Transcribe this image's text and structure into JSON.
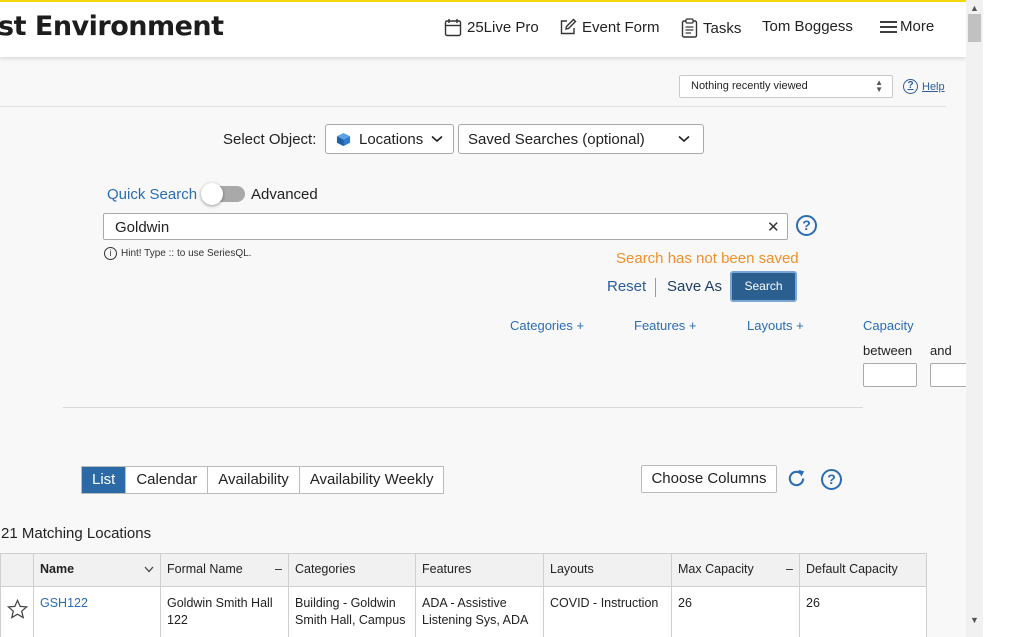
{
  "header": {
    "env_title": "st Environment",
    "nav": [
      {
        "label": "25Live Pro",
        "icon": "calendar-icon"
      },
      {
        "label": "Event Form",
        "icon": "edit-icon"
      },
      {
        "label": "Tasks",
        "icon": "clipboard-icon"
      },
      {
        "label": "Tom Boggess"
      },
      {
        "label": "More",
        "icon": "hamburger-icon"
      }
    ]
  },
  "subbar": {
    "recently_viewed": "Nothing recently viewed",
    "help_label": "Help"
  },
  "search": {
    "select_object_label": "Select Object:",
    "object_type": "Locations",
    "saved_searches_placeholder": "Saved Searches (optional)",
    "quick_search_label": "Quick Search",
    "advanced_label": "Advanced",
    "query": "Goldwin",
    "hint": "Hint! Type :: to use SeriesQL.",
    "status": "Search has not been saved",
    "reset_label": "Reset",
    "save_as_label": "Save As",
    "search_label": "Search"
  },
  "filters": {
    "categories": "Categories +",
    "features": "Features +",
    "layouts": "Layouts +",
    "capacity_label": "Capacity",
    "between_label": "between",
    "and_label": "and"
  },
  "results": {
    "tabs": [
      "List",
      "Calendar",
      "Availability",
      "Availability Weekly"
    ],
    "active_tab": "List",
    "choose_columns_label": "Choose Columns",
    "matching_text": "21 Matching Locations",
    "columns": [
      "Name",
      "Formal Name",
      "Categories",
      "Features",
      "Layouts",
      "Max Capacity",
      "Default Capacity"
    ],
    "rows": [
      {
        "name": "GSH122",
        "formal_name": "Goldwin Smith Hall 122",
        "categories": "Building - Goldwin Smith Hall, Campus",
        "features": "ADA - Assistive Listening Sys, ADA",
        "layouts": "COVID - Instruction",
        "max_capacity": "26",
        "default_capacity": "26"
      }
    ]
  },
  "colors": {
    "accent_blue": "#2a6db5",
    "active_tab": "#2b6aa6",
    "search_button": "#2b5f8f",
    "warning_orange": "#f0902a",
    "top_stripe": "#f5d90a"
  }
}
